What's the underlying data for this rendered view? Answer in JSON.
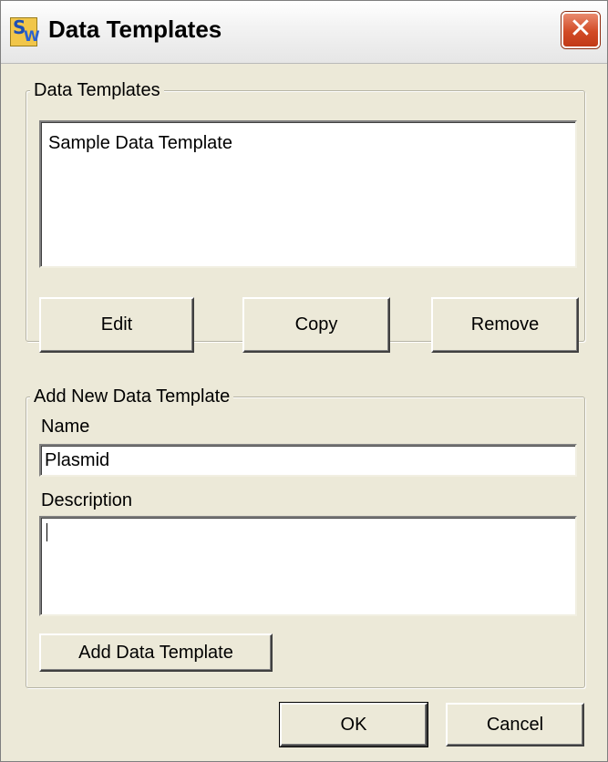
{
  "window": {
    "title": "Data Templates",
    "icon": "app-sw-icon",
    "close_glyph": "✕"
  },
  "templates_group": {
    "label": "Data Templates",
    "items": [
      {
        "label": "Sample Data Template"
      }
    ],
    "edit_label": "Edit",
    "copy_label": "Copy",
    "remove_label": "Remove"
  },
  "add_group": {
    "label": "Add New Data Template",
    "name_label": "Name",
    "name_value": "Plasmid",
    "description_label": "Description",
    "description_value": "",
    "add_label": "Add Data Template"
  },
  "footer": {
    "ok_label": "OK",
    "cancel_label": "Cancel"
  },
  "colors": {
    "dialog_bg": "#ece9d8",
    "close_red": "#d24b26"
  }
}
